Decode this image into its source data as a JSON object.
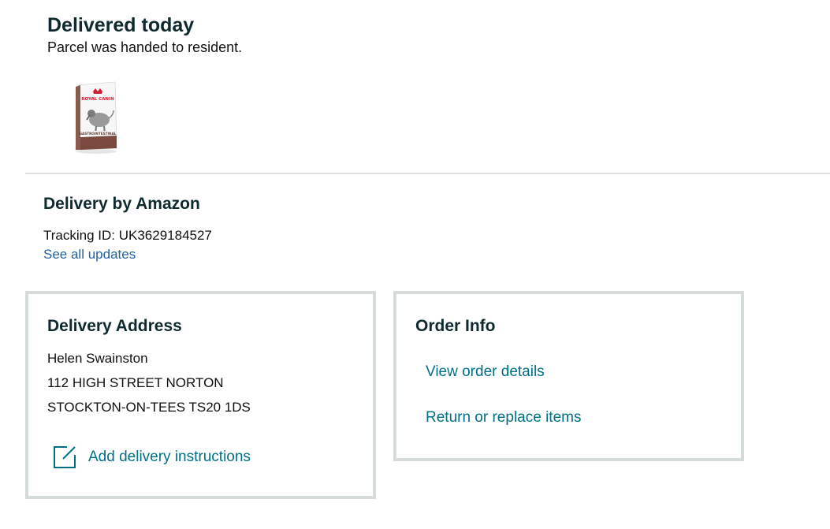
{
  "status": {
    "title": "Delivered today",
    "subtitle": "Parcel was handed to resident."
  },
  "product": {
    "image_icon": "dog-food-bag-image",
    "brand_text": "ROYAL CANIN",
    "variant_text": "GASTROINTESTINAL"
  },
  "carrier": {
    "title": "Delivery by Amazon",
    "tracking_line": "Tracking ID: UK3629184527",
    "see_updates_label": "See all updates"
  },
  "delivery_address": {
    "title": "Delivery Address",
    "name": "Helen Swainston",
    "street": "112 HIGH STREET NORTON",
    "city_postcode": "STOCKTON-ON-TEES TS20 1DS",
    "instructions_icon": "edit-note-icon",
    "add_instructions_label": "Add delivery instructions"
  },
  "order_info": {
    "title": "Order Info",
    "view_details_label": "View order details",
    "return_label": "Return or replace items"
  },
  "colors": {
    "link": "#007185",
    "link_blue": "#2162a1",
    "heading": "#0f2a2e",
    "card_border": "#d5dbdb",
    "divider": "#dde0e0"
  }
}
